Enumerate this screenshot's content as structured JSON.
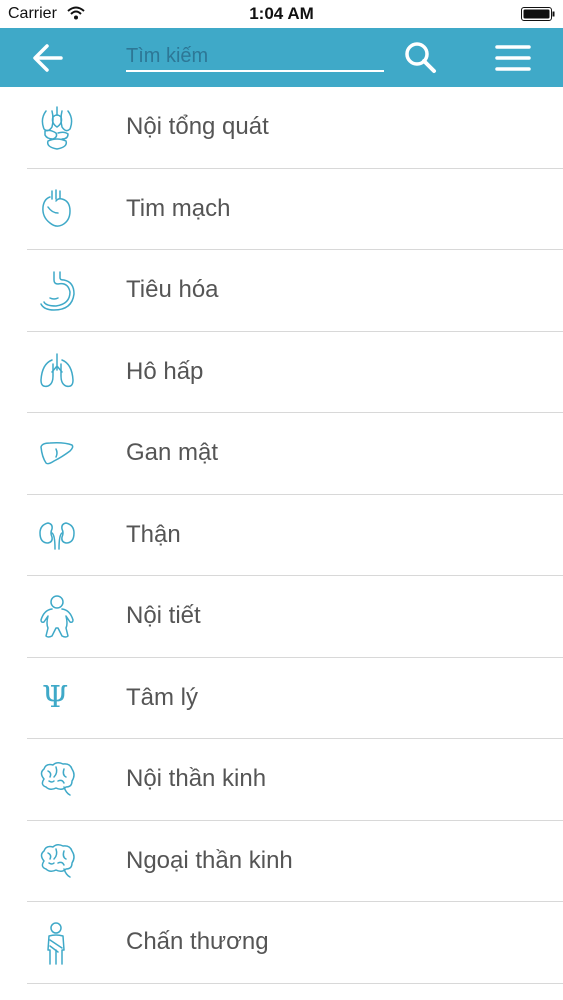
{
  "status_bar": {
    "carrier": "Carrier",
    "time": "1:04 AM"
  },
  "nav": {
    "search_placeholder": "Tìm kiếm",
    "accent_color": "#3fa9c8"
  },
  "list": {
    "items": [
      {
        "label": "Nội tổng quát",
        "icon": "internal-organs-icon"
      },
      {
        "label": "Tim mạch",
        "icon": "heart-icon"
      },
      {
        "label": "Tiêu hóa",
        "icon": "stomach-icon"
      },
      {
        "label": "Hô hấp",
        "icon": "lungs-icon"
      },
      {
        "label": "Gan mật",
        "icon": "liver-icon"
      },
      {
        "label": "Thận",
        "icon": "kidneys-icon"
      },
      {
        "label": "Nội tiết",
        "icon": "child-body-icon"
      },
      {
        "label": "Tâm lý",
        "icon": "psi-icon"
      },
      {
        "label": "Nội thần kinh",
        "icon": "brain-icon"
      },
      {
        "label": "Ngoại thần kinh",
        "icon": "brain-icon"
      },
      {
        "label": "Chấn thương",
        "icon": "injured-person-icon"
      }
    ]
  }
}
